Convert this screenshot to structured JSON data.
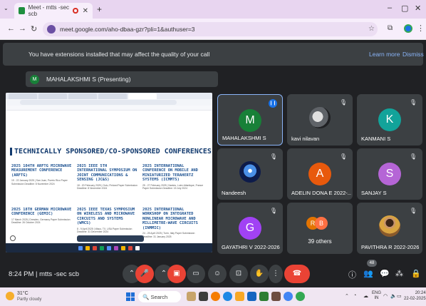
{
  "browser": {
    "tab_title": "Meet - mtts -sec scb",
    "url": "meet.google.com/aho-dbaa-gzr?pli=1&authuser=3"
  },
  "banner": {
    "message": "You have extensions installed that may affect the quality of your call",
    "learn_more": "Learn more",
    "dismiss": "Dismiss"
  },
  "presenting": {
    "initial": "M",
    "label": "MAHALAKSHMI S (Presenting)"
  },
  "shared_screen": {
    "heading": "TECHNICALLY SPONSORED/CO-SPONSORED CONFERENCES",
    "conferences": [
      {
        "title": "2025 104TH ARFTG MICROWAVE MEASUREMENT CONFERENCE (ARFTG)",
        "details": "19 - 22 January 2025 | San Juan, Puerto Rico Paper Submission Deadline: 8 November 2024"
      },
      {
        "title": "2025 IEEE 5TH INTERNATIONAL SYMPOSIUM ON JOINT COMMUNICATIONS & SENSING (JC&S)",
        "details": "18 - 20 February 2025 | Oulu, Finland Paper Submission Deadline: 8 November 2024"
      },
      {
        "title": "2025 INTERNATIONAL CONFERENCE ON MOBILE AND MINIATURIZED TERAHERTZ SYSTEMS (ICMMTS)",
        "details": "25 - 27 February 2025 | Nantes, Loire-Atlantique, France Paper Submission Deadline: 15 July 2024"
      },
      {
        "title": "2025 18TH GERMAN MICROWAVE CONFERENCE (GEMIC)",
        "details": "17 March 2025 | Dresden, Germany Paper Submission Deadline: 26 October 2024"
      },
      {
        "title": "2025 IEEE TEXAS SYMPOSIUM ON WIRELESS AND MICROWAVE CIRCUITS AND SYSTEMS (WMCS)",
        "details": "8 - 9 April 2025 | Waco, TX, USA Paper Submission Deadline: 31 December 2024"
      },
      {
        "title": "2025 INTERNATIONAL WORKSHOP ON INTEGRATED NONLINEAR MICROWAVE AND MILLIMETRE-WAVE CIRCUITS (INMMIC)",
        "details": "24 - 25 April 2025 | Turin, Italy Paper Submission Deadline: 31 January 2025"
      }
    ]
  },
  "participants": [
    {
      "name": "MAHALAKSHMI S",
      "initial": "M",
      "color": "#188038",
      "type": "initial",
      "speaking": true
    },
    {
      "name": "kavi nilavan",
      "initial": "",
      "color": "#3c4043",
      "type": "photo-bike",
      "speaking": false
    },
    {
      "name": "KANMANI S",
      "initial": "K",
      "color": "#12a39a",
      "type": "initial",
      "speaking": false
    },
    {
      "name": "Nandeesh",
      "initial": "",
      "color": "#1a2f6b",
      "type": "photo-sky",
      "speaking": false
    },
    {
      "name": "ADELIN DONA E 2022-...",
      "initial": "A",
      "color": "#e8590c",
      "type": "initial",
      "speaking": false
    },
    {
      "name": "SANJAY S",
      "initial": "S",
      "color": "#b565d6",
      "type": "initial",
      "speaking": false
    },
    {
      "name": "GAYATHRI V 2022-2026",
      "initial": "G",
      "color": "#a142f4",
      "type": "initial",
      "speaking": false
    },
    {
      "name": "39 others",
      "initial": "",
      "color": "#3c4043",
      "type": "others",
      "speaking": false
    },
    {
      "name": "PAVITHRA R 2022-2026",
      "initial": "",
      "color": "#3c4043",
      "type": "photo-person",
      "speaking": false
    }
  ],
  "others_bubbles": [
    "R",
    "B"
  ],
  "controls": {
    "time": "8:24 PM",
    "separator": "|",
    "meeting_code": "mtts -sec scb",
    "people_count": "48"
  },
  "taskbar": {
    "temperature": "31°C",
    "weather": "Partly cloudy",
    "search_placeholder": "Search",
    "lang_line1": "ENG",
    "lang_line2": "IN",
    "clock_time": "20:24",
    "clock_date": "22-02-2025"
  },
  "colors": {
    "meet_bg": "#202124",
    "tile_bg": "#3c4043",
    "accent_blue": "#8ab4f8",
    "end_call_red": "#ea4335"
  }
}
